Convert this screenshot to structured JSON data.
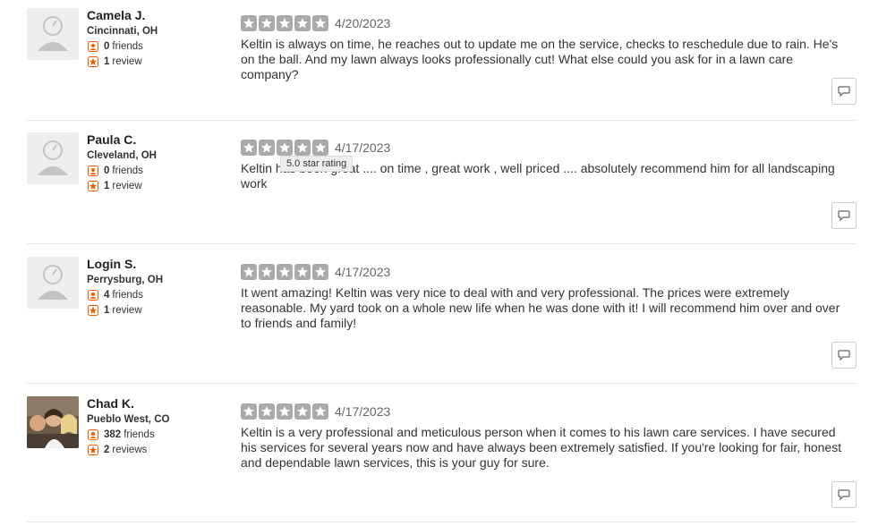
{
  "reviews": [
    {
      "user": {
        "name": "Camela J.",
        "location": "Cincinnati, OH",
        "friends_count": "0",
        "friends_label": "friends",
        "reviews_count": "1",
        "reviews_label": "review",
        "avatar": "default-avatar"
      },
      "rating": 5,
      "date": "4/20/2023",
      "text": "Keltin is always on time, he reaches out to update me on the service, checks to reschedule due to rain. He's on the ball. And my lawn always looks professionally cut! What else could you ask for in a lawn care company?"
    },
    {
      "user": {
        "name": "Paula C.",
        "location": "Cleveland, OH",
        "friends_count": "0",
        "friends_label": "friends",
        "reviews_count": "1",
        "reviews_label": "review",
        "avatar": "default-avatar"
      },
      "rating": 5,
      "date": "4/17/2023",
      "text": "Keltin has been great .... on time , great work , well priced .... absolutely recommend him for all landscaping work",
      "tooltip": "5.0 star rating"
    },
    {
      "user": {
        "name": "Login S.",
        "location": "Perrysburg, OH",
        "friends_count": "4",
        "friends_label": "friends",
        "reviews_count": "1",
        "reviews_label": "review",
        "avatar": "default-avatar"
      },
      "rating": 5,
      "date": "4/17/2023",
      "text": "It went amazing! Keltin was very nice to deal with and very professional. The prices were extremely reasonable. My yard took on a whole new life when he was done with it! I will recommend him over and over to friends and family!"
    },
    {
      "user": {
        "name": "Chad K.",
        "location": "Pueblo West, CO",
        "friends_count": "382",
        "friends_label": "friends",
        "reviews_count": "2",
        "reviews_label": "reviews",
        "avatar": "photo-avatar"
      },
      "rating": 5,
      "date": "4/17/2023",
      "text": "Keltin is a very professional and meticulous person when it comes to his lawn care services. I have secured his services for several years now and have always been extremely satisfied. If you're looking for fair, honest and dependable lawn services, this is your guy for sure."
    }
  ],
  "icons": {
    "friends": "friends-icon",
    "review": "review-star-icon",
    "star": "star-icon",
    "compliment": "speech-bubble-icon"
  },
  "colors": {
    "star_fill": "#aaaaaa",
    "badge_orange": "#f15c00",
    "divider": "#e6e6e6"
  }
}
